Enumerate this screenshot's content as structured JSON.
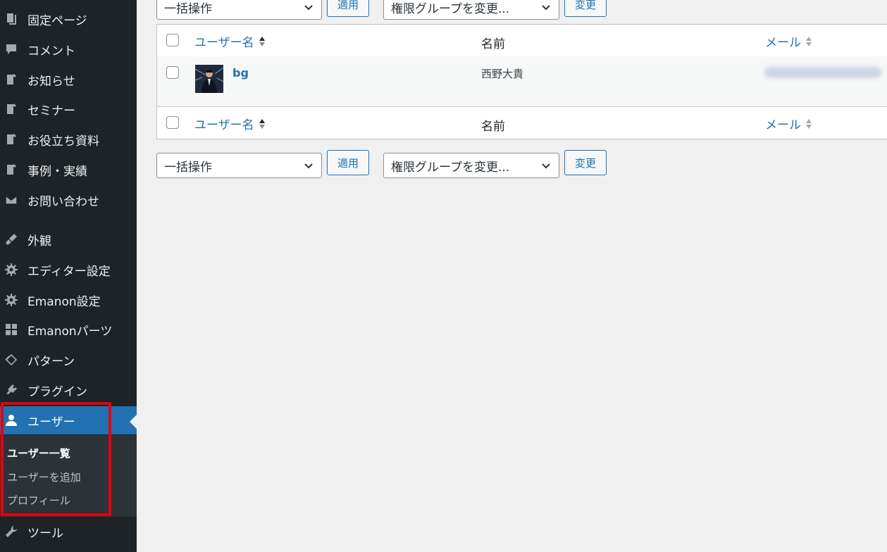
{
  "sidebar": {
    "items": [
      {
        "label": "固定ページ",
        "icon": "pages-icon"
      },
      {
        "label": "コメント",
        "icon": "comment-icon"
      },
      {
        "label": "お知らせ",
        "icon": "post-icon"
      },
      {
        "label": "セミナー",
        "icon": "post-icon"
      },
      {
        "label": "お役立ち資料",
        "icon": "post-icon"
      },
      {
        "label": "事例・実績",
        "icon": "post-icon"
      },
      {
        "label": "お問い合わせ",
        "icon": "envelope-icon"
      },
      {
        "label": "外観",
        "icon": "brush-icon"
      },
      {
        "label": "エディター設定",
        "icon": "gear-icon"
      },
      {
        "label": "Emanon設定",
        "icon": "gear-icon"
      },
      {
        "label": "Emanonパーツ",
        "icon": "grid-icon"
      },
      {
        "label": "パターン",
        "icon": "diamond-icon"
      },
      {
        "label": "プラグイン",
        "icon": "plugin-icon"
      },
      {
        "label": "ユーザー",
        "icon": "user-icon",
        "active": true
      },
      {
        "label": "ツール",
        "icon": "wrench-icon"
      }
    ],
    "submenu": [
      {
        "label": "ユーザー一覧",
        "current": true
      },
      {
        "label": "ユーザーを追加"
      },
      {
        "label": "プロフィール"
      }
    ]
  },
  "bulk_actions": {
    "select_value": "一括操作",
    "apply_label": "適用",
    "role_select_value": "権限グループを変更...",
    "change_label": "変更"
  },
  "table": {
    "columns": {
      "username": "ユーザー名",
      "name": "名前",
      "email": "メール"
    },
    "rows": [
      {
        "username": "bg",
        "name": "西野大貴"
      }
    ]
  },
  "colors": {
    "accent": "#2271b1",
    "sidebar_bg": "#1d2327",
    "highlight": "#e3000f"
  }
}
